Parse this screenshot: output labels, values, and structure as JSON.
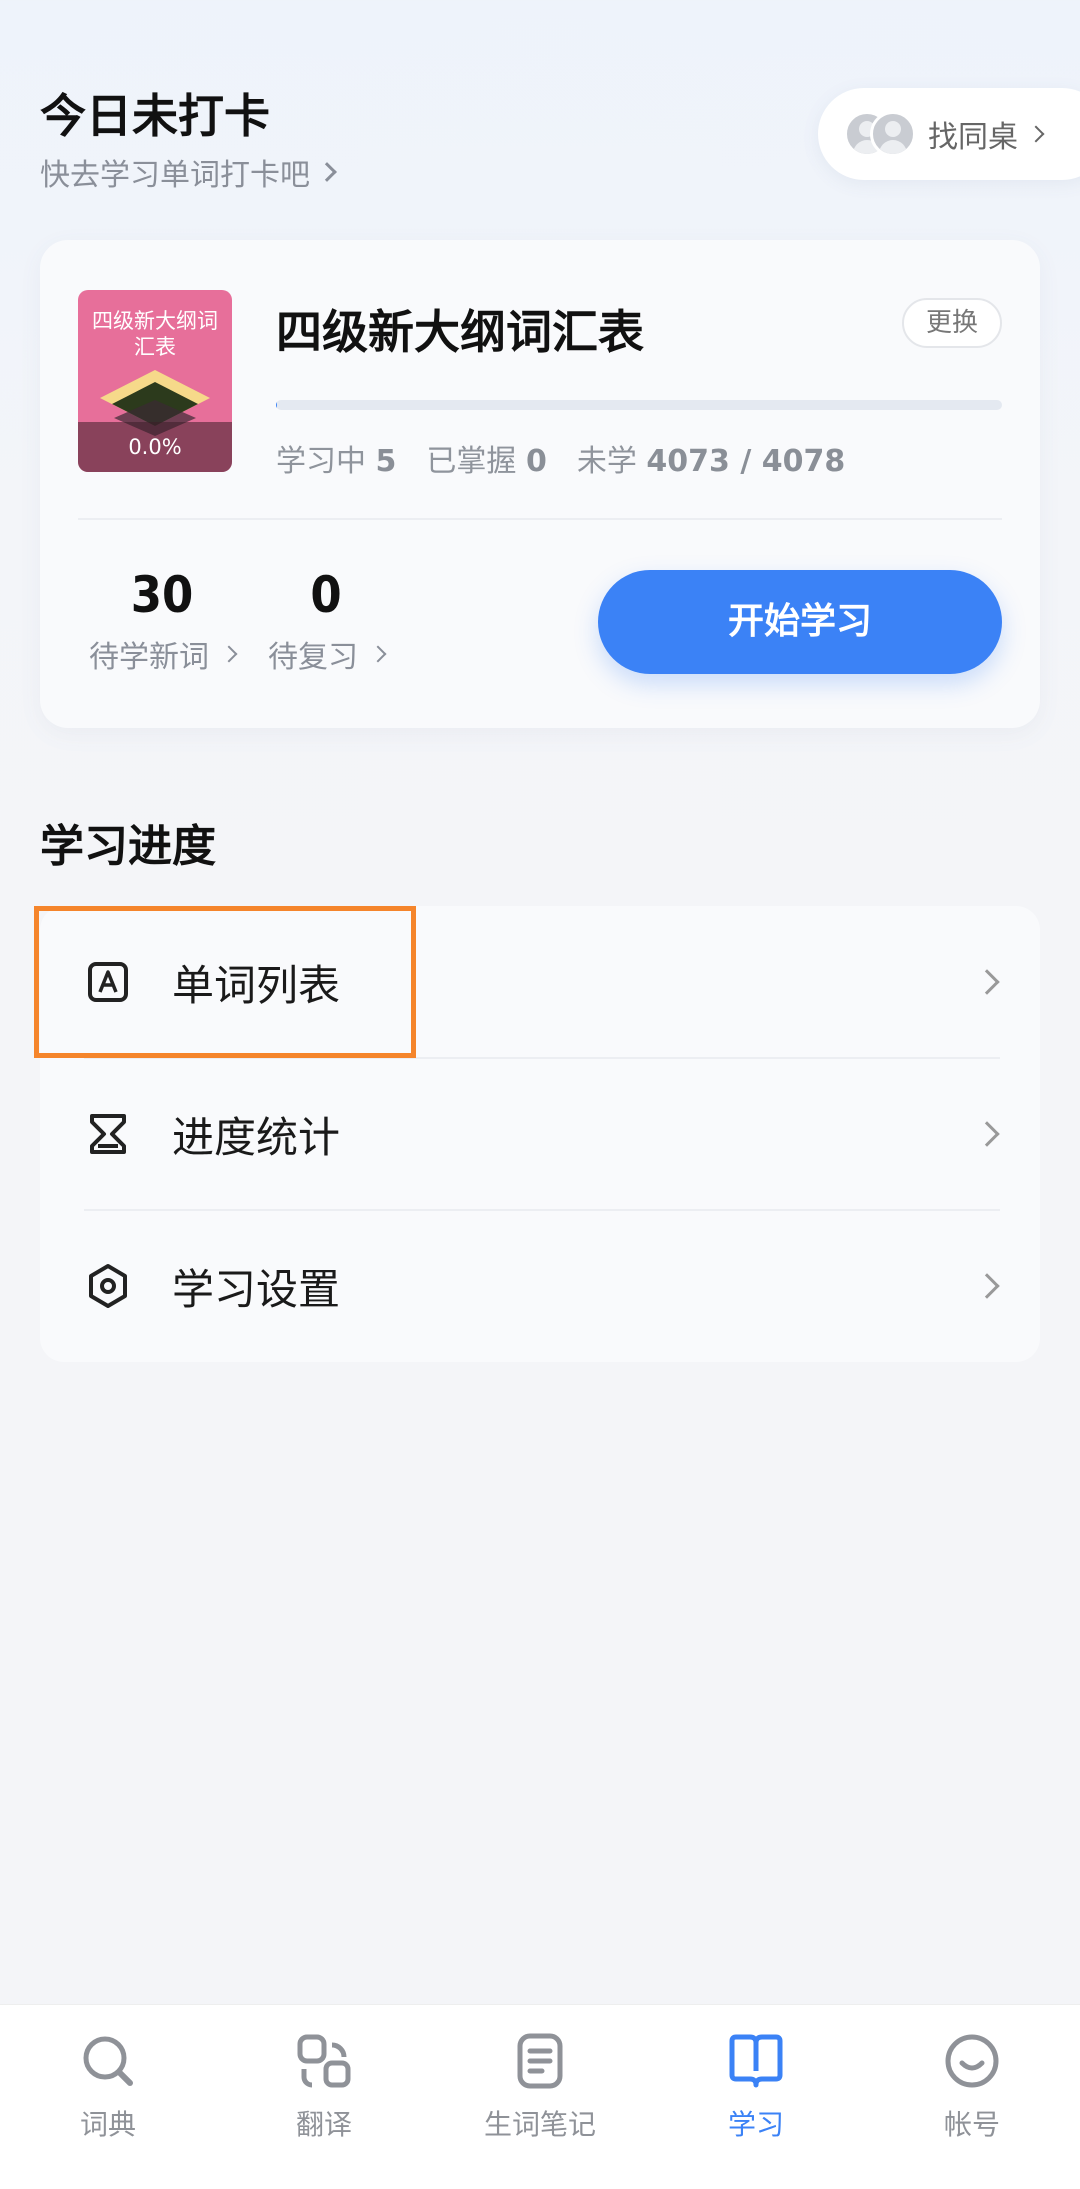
{
  "header": {
    "title": "今日未打卡",
    "subtitle": "快去学习单词打卡吧",
    "find_desk_label": "找同桌"
  },
  "book": {
    "cover_title": "四级新大纲词汇表",
    "cover_progress": "0.0%",
    "name": "四级新大纲词汇表",
    "change_label": "更换",
    "progress_fraction": 0.001,
    "learning_label": "学习中",
    "learning_count": "5",
    "mastered_label": "已掌握",
    "mastered_count": "0",
    "unlearned_label": "未学",
    "unlearned_count": "4073 / 4078",
    "new_words_count": "30",
    "new_words_label": "待学新词",
    "review_count": "0",
    "review_label": "待复习",
    "start_label": "开始学习"
  },
  "section": {
    "title": "学习进度",
    "items": [
      {
        "label": "单词列表",
        "icon": "word-list-icon"
      },
      {
        "label": "进度统计",
        "icon": "hourglass-icon"
      },
      {
        "label": "学习设置",
        "icon": "settings-icon"
      }
    ]
  },
  "nav": {
    "items": [
      {
        "label": "词典",
        "icon": "search-icon"
      },
      {
        "label": "翻译",
        "icon": "translate-icon"
      },
      {
        "label": "生词笔记",
        "icon": "notebook-icon"
      },
      {
        "label": "学习",
        "icon": "book-icon"
      },
      {
        "label": "帐号",
        "icon": "smile-icon"
      }
    ],
    "active_index": 3
  },
  "colors": {
    "accent": "#3b82f6",
    "highlight": "#f5852b",
    "cover": "#e76f9a"
  }
}
